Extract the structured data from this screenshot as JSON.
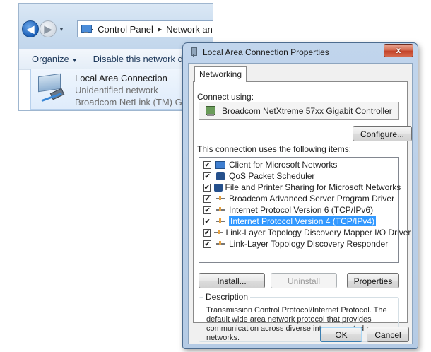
{
  "explorer": {
    "breadcrumb": [
      "Control Panel",
      "Network and"
    ],
    "toolbar": {
      "organize": "Organize",
      "disable": "Disable this network de"
    },
    "connection": {
      "name": "Local Area Connection",
      "status": "Unidentified network",
      "adapter": "Broadcom NetLink (TM) Gigab"
    },
    "icons": {
      "back": "back-arrow-icon",
      "forward": "forward-arrow-icon",
      "control_panel": "control-panel-icon",
      "network": "network-adapter-icon"
    }
  },
  "dialog": {
    "title": "Local Area Connection Properties",
    "close_label": "x",
    "tab": "Networking",
    "connect_using_label": "Connect using:",
    "adapter_name": "Broadcom NetXtreme 57xx Gigabit Controller",
    "configure_button": "Configure...",
    "items_label": "This connection uses the following items:",
    "items": [
      {
        "label": "Client for Microsoft Networks",
        "checked": true,
        "icon": "client-icon",
        "selected": false
      },
      {
        "label": "QoS Packet Scheduler",
        "checked": true,
        "icon": "qos-icon",
        "selected": false
      },
      {
        "label": "File and Printer Sharing for Microsoft Networks",
        "checked": true,
        "icon": "share-icon",
        "selected": false
      },
      {
        "label": "Broadcom Advanced Server Program Driver",
        "checked": true,
        "icon": "protocol-icon",
        "selected": false
      },
      {
        "label": "Internet Protocol Version 6 (TCP/IPv6)",
        "checked": true,
        "icon": "protocol-icon",
        "selected": false
      },
      {
        "label": "Internet Protocol Version 4 (TCP/IPv4)",
        "checked": true,
        "icon": "protocol-icon",
        "selected": true
      },
      {
        "label": "Link-Layer Topology Discovery Mapper I/O Driver",
        "checked": true,
        "icon": "protocol-icon",
        "selected": false
      },
      {
        "label": "Link-Layer Topology Discovery Responder",
        "checked": true,
        "icon": "protocol-icon",
        "selected": false
      }
    ],
    "install_button": "Install...",
    "uninstall_button": "Uninstall",
    "properties_button": "Properties",
    "description_legend": "Description",
    "description_text": "Transmission Control Protocol/Internet Protocol. The default wide area network protocol that provides communication across diverse interconnected networks.",
    "ok_button": "OK",
    "cancel_button": "Cancel"
  },
  "colors": {
    "selection": "#3399ff",
    "title_bar": "#b5cbe5",
    "close_button": "#c3442a"
  }
}
